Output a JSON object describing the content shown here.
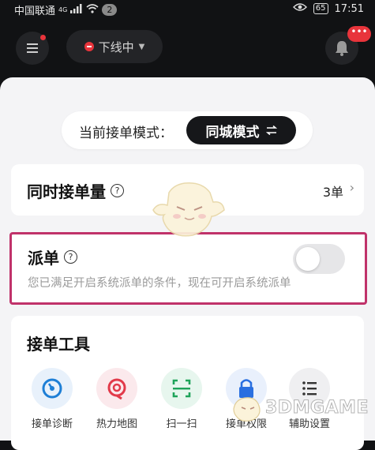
{
  "status_bar": {
    "carrier": "中国联通",
    "network": "4G",
    "notification_count": "2",
    "battery": "65",
    "time": "17:51"
  },
  "app_bar": {
    "status_label": "下线中",
    "more_badge": "•••"
  },
  "sheet": {
    "mode_label": "当前接单模式：",
    "mode_value": "同城模式",
    "concurrent_orders": {
      "title": "同时接单量",
      "value": "3单"
    },
    "dispatch": {
      "title": "派单",
      "description": "您已满足开启系统派单的条件，现在可开启系统派单",
      "enabled": false
    },
    "tools": {
      "title": "接单工具",
      "items": [
        {
          "label": "接单诊断",
          "icon": "diagnosis-icon",
          "color": "#1e7fd6"
        },
        {
          "label": "热力地图",
          "icon": "heatmap-icon",
          "color": "#e23a4a"
        },
        {
          "label": "扫一扫",
          "icon": "scan-icon",
          "color": "#1fa35a"
        },
        {
          "label": "接单权限",
          "icon": "lock-icon",
          "color": "#2a6fe0"
        },
        {
          "label": "辅助设置",
          "icon": "list-icon",
          "color": "#333333"
        }
      ]
    }
  },
  "watermark": {
    "text": "3DMGAME"
  }
}
